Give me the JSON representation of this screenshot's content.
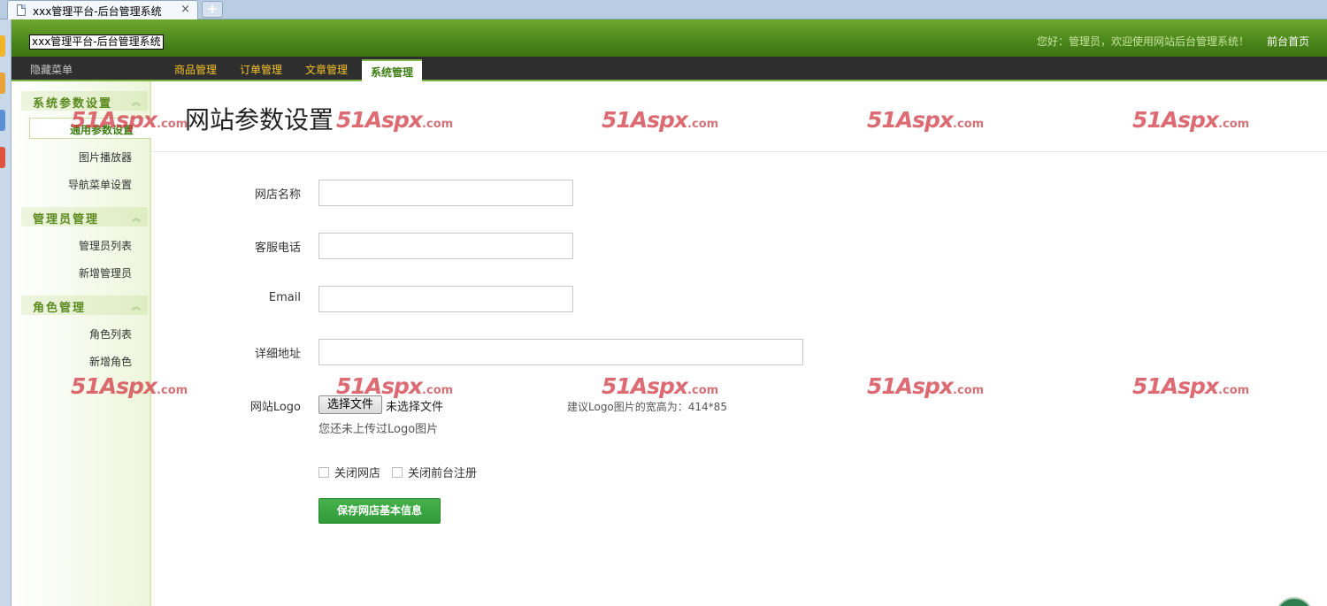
{
  "browser": {
    "tab_title": "xxx管理平台-后台管理系统",
    "tab_close": "×",
    "new_tab": "+"
  },
  "header": {
    "logo_text": "xxx管理平台-后台管理系统",
    "welcome": "您好：管理员，欢迎使用网站后台管理系统！",
    "home_link": "前台首页"
  },
  "nav": {
    "hide_menu": "隐藏菜单",
    "items": [
      {
        "label": "商品管理"
      },
      {
        "label": "订单管理"
      },
      {
        "label": "文章管理"
      },
      {
        "label": "系统管理"
      }
    ]
  },
  "sidebar": {
    "sections": [
      {
        "title": "系统参数设置",
        "arrow": "︽",
        "items": [
          "通用参数设置",
          "图片播放器",
          "导航菜单设置"
        ]
      },
      {
        "title": "管理员管理",
        "arrow": "︽",
        "items": [
          "管理员列表",
          "新增管理员"
        ]
      },
      {
        "title": "角色管理",
        "arrow": "︽",
        "items": [
          "角色列表",
          "新增角色"
        ]
      }
    ]
  },
  "main": {
    "title": "网站参数设置",
    "fields": {
      "shop_name_label": "网店名称",
      "shop_name_value": "",
      "phone_label": "客服电话",
      "phone_value": "",
      "email_label": "Email",
      "email_value": "",
      "address_label": "详细地址",
      "address_value": "",
      "logo_label": "网站Logo"
    },
    "file_button": "选择文件",
    "file_none": "未选择文件",
    "logo_hint": "建议Logo图片的宽高为：414*85",
    "logo_status": "您还未上传过Logo图片",
    "checkbox_close_shop": "关闭网店",
    "checkbox_close_register": "关闭前台注册",
    "save_button": "保存网店基本信息"
  },
  "watermark": {
    "main": "51Aspx",
    "suffix": ".com"
  },
  "colors": {
    "header_green": "#4a861a",
    "nav_dark": "#2e2e2e",
    "nav_text": "#f5c22b",
    "save_green": "#3aa542",
    "watermark_red": "#d23a45"
  }
}
